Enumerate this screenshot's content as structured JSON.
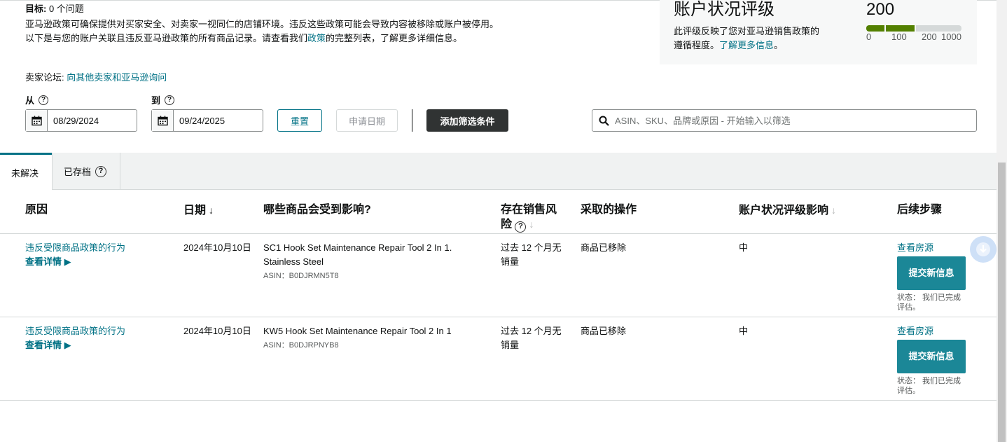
{
  "intro": {
    "goal_label": "目标:",
    "goal_value": "0 个问题",
    "text_before_link": "亚马逊政策可确保提供对买家安全、对卖家一视同仁的店铺环境。违反这些政策可能会导致内容被移除或账户被停用。以下是与您的账户关联且违反亚马逊政策的所有商品记录。请查看我们",
    "policy_link": "政策",
    "text_after_link": "的完整列表，了解更多详细信息。",
    "forum_label": "卖家论坛:",
    "forum_link": "向其他卖家和亚马逊询问"
  },
  "health": {
    "title": "账户状况评级",
    "score": "200",
    "desc": "此评级反映了您对亚马逊销售政策的遵循程度。",
    "learn_more": "了解更多信息",
    "desc_end": "。",
    "ticks": [
      "0",
      "100",
      "200",
      "1000"
    ],
    "colors": {
      "good": "#538000",
      "empty": "#d5d9d9"
    }
  },
  "filters": {
    "from_label": "从",
    "to_label": "到",
    "from_value": "08/29/2024",
    "to_value": "09/24/2025",
    "reset": "重置",
    "apply": "申请日期",
    "add_filter": "添加筛选条件",
    "search_placeholder": "ASIN、SKU、品牌或原因 - 开始输入以筛选"
  },
  "tabs": {
    "unresolved": "未解决",
    "archived": "已存档"
  },
  "table": {
    "headers": {
      "reason": "原因",
      "date": "日期",
      "affected": "哪些商品会受到影响?",
      "risk": "存在销售风险",
      "action": "采取的操作",
      "impact": "账户状况评级影响",
      "next": "后续步骤"
    },
    "rows": [
      {
        "reason": "违反受限商品政策的行为",
        "details": "查看详情 ▶",
        "date": "2024年10月10日",
        "product": "SC1 Hook Set Maintenance Repair Tool 2 In 1. Stainless Steel",
        "asin": "ASIN：B0DJRMN5T8",
        "risk": "过去 12 个月无销量",
        "action": "商品已移除",
        "impact": "中",
        "listing_link": "查看房源",
        "submit": "提交新信息",
        "status": "状态：  我们已完成评估。"
      },
      {
        "reason": "违反受限商品政策的行为",
        "details": "查看详情 ▶",
        "date": "2024年10月10日",
        "product": "KW5 Hook Set Maintenance Repair Tool 2 In 1",
        "asin": "ASIN：B0DJRPNYB8",
        "risk": "过去 12 个月无销量",
        "action": "商品已移除",
        "impact": "中",
        "listing_link": "查看房源",
        "submit": "提交新信息",
        "status": "状态：  我们已完成评估。"
      }
    ]
  }
}
